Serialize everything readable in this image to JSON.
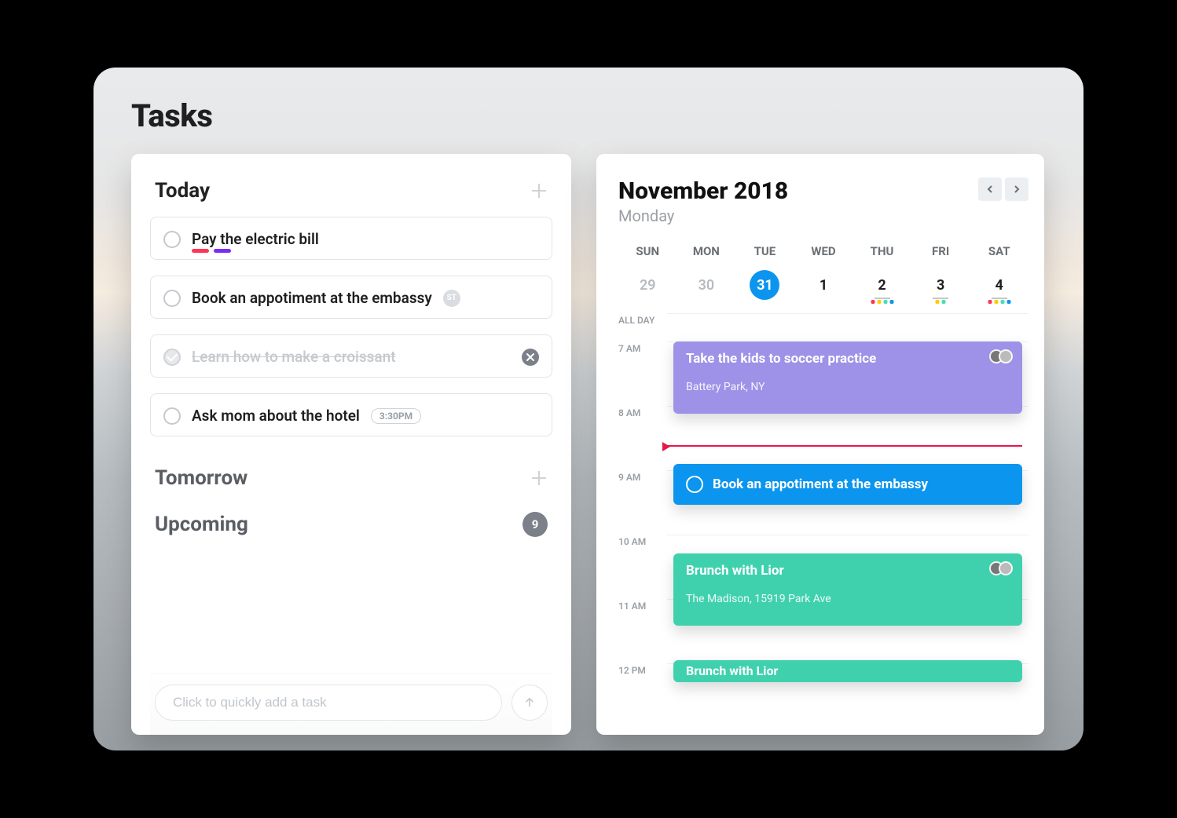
{
  "page": {
    "title": "Tasks"
  },
  "tasks_panel": {
    "sections": {
      "today": {
        "title": "Today"
      },
      "tomorrow": {
        "title": "Tomorrow"
      },
      "upcoming": {
        "title": "Upcoming",
        "count": "9"
      }
    },
    "today_items": [
      {
        "title": "Pay the electric bill",
        "done": false,
        "tagColors": [
          "#ff3558",
          "#7a2ff0"
        ]
      },
      {
        "title": "Book an appotiment at the embassy",
        "done": false,
        "badge": "ST"
      },
      {
        "title": "Learn how to make a croissant",
        "done": true
      },
      {
        "title": "Ask mom about the hotel",
        "done": false,
        "time": "3:30PM"
      }
    ],
    "quick_add": {
      "placeholder": "Click to quickly add a task"
    }
  },
  "calendar": {
    "title": "November 2018",
    "subtitle": "Monday",
    "dow": [
      "SUN",
      "MON",
      "TUE",
      "WED",
      "THU",
      "FRI",
      "SAT"
    ],
    "dates": [
      {
        "n": "29",
        "dim": true
      },
      {
        "n": "30",
        "dim": true
      },
      {
        "n": "31",
        "selected": true
      },
      {
        "n": "1"
      },
      {
        "n": "2",
        "dots": [
          "#ff3558",
          "#ffcc00",
          "#46e0b1",
          "#0b95ee"
        ],
        "underline": true
      },
      {
        "n": "3",
        "dots": [
          "#ffcc00",
          "#46e0b1"
        ],
        "underline": true
      },
      {
        "n": "4",
        "dots": [
          "#ff3558",
          "#ffcc00",
          "#46e0b1",
          "#0b95ee"
        ],
        "underline": true
      }
    ],
    "allday_label": "ALL DAY",
    "hours": [
      "7 AM",
      "8 AM",
      "9 AM",
      "10 AM",
      "11 AM",
      "12 PM"
    ],
    "events": [
      {
        "title": "Take the kids to soccer practice",
        "sub": "Battery Park, NY"
      },
      {
        "title": "Book an appotiment at the embassy"
      },
      {
        "title": "Brunch with Lior",
        "sub": "The Madison, 15919 Park Ave"
      },
      {
        "title": "Brunch with Lior"
      }
    ]
  }
}
